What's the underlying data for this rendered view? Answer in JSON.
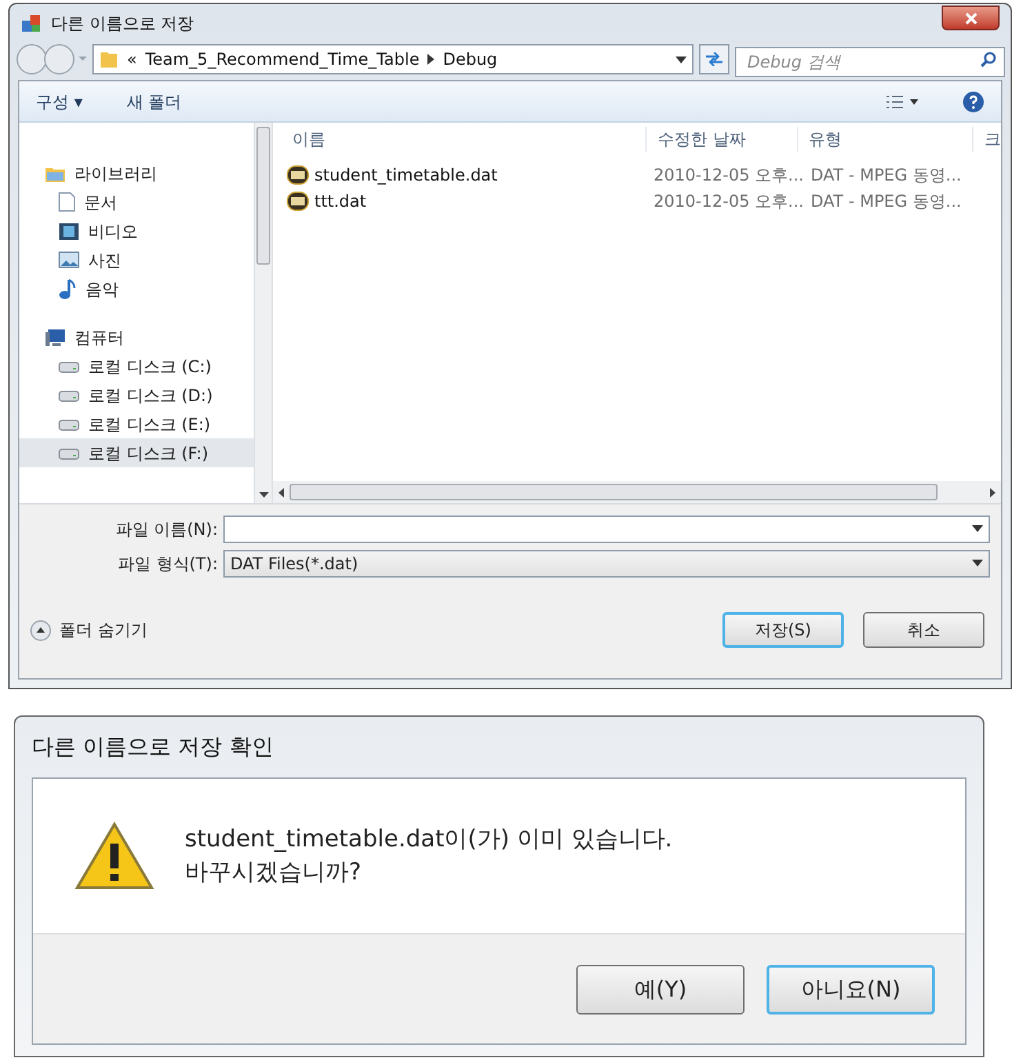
{
  "save_dialog": {
    "title": "다른 이름으로 저장",
    "breadcrumb": {
      "overflow": "«",
      "items": [
        "Team_5_Recommend_Time_Table",
        "Debug"
      ]
    },
    "search": {
      "placeholder": "Debug 검색"
    },
    "toolbar": {
      "organize": "구성 ▾",
      "new_folder": "새 폴더"
    },
    "sidebar": [
      {
        "label": "라이브러리",
        "kind": "library",
        "selected": false,
        "children": [
          {
            "label": "문서",
            "kind": "document",
            "selected": false
          },
          {
            "label": "비디오",
            "kind": "video",
            "selected": false
          },
          {
            "label": "사진",
            "kind": "picture",
            "selected": false
          },
          {
            "label": "음악",
            "kind": "music",
            "selected": false
          }
        ]
      },
      {
        "label": "컴퓨터",
        "kind": "computer",
        "selected": false,
        "children": [
          {
            "label": "로컬 디스크 (C:)",
            "kind": "drive",
            "selected": false
          },
          {
            "label": "로컬 디스크 (D:)",
            "kind": "drive",
            "selected": false
          },
          {
            "label": "로컬 디스크 (E:)",
            "kind": "drive",
            "selected": false
          },
          {
            "label": "로컬 디스크 (F:)",
            "kind": "drive",
            "selected": true
          }
        ]
      }
    ],
    "table": {
      "columns": [
        "이름",
        "수정한 날짜",
        "유형",
        "크"
      ],
      "rows": [
        {
          "name": "student_timetable.dat",
          "date": "2010-12-05 오후...",
          "type": "DAT - MPEG 동영..."
        },
        {
          "name": "ttt.dat",
          "date": "2010-12-05 오후...",
          "type": "DAT - MPEG 동영..."
        }
      ]
    },
    "file_name": {
      "label": "파일 이름(N):"
    },
    "file_type": {
      "label": "파일 형식(T):",
      "value": "DAT Files(*.dat)"
    },
    "hide_folders": "폴더 숨기기",
    "buttons": [
      {
        "label": "저장(S)",
        "focused": true
      },
      {
        "label": "취소",
        "focused": false
      }
    ]
  },
  "confirm_dialog": {
    "title": "다른 이름으로 저장 확인",
    "message": [
      "student_timetable.dat이(가) 이미 있습니다.",
      "바꾸시겠습니까?"
    ],
    "buttons": [
      {
        "label": "예(Y)",
        "focused": false
      },
      {
        "label": "아니요(N)",
        "focused": true
      }
    ]
  }
}
